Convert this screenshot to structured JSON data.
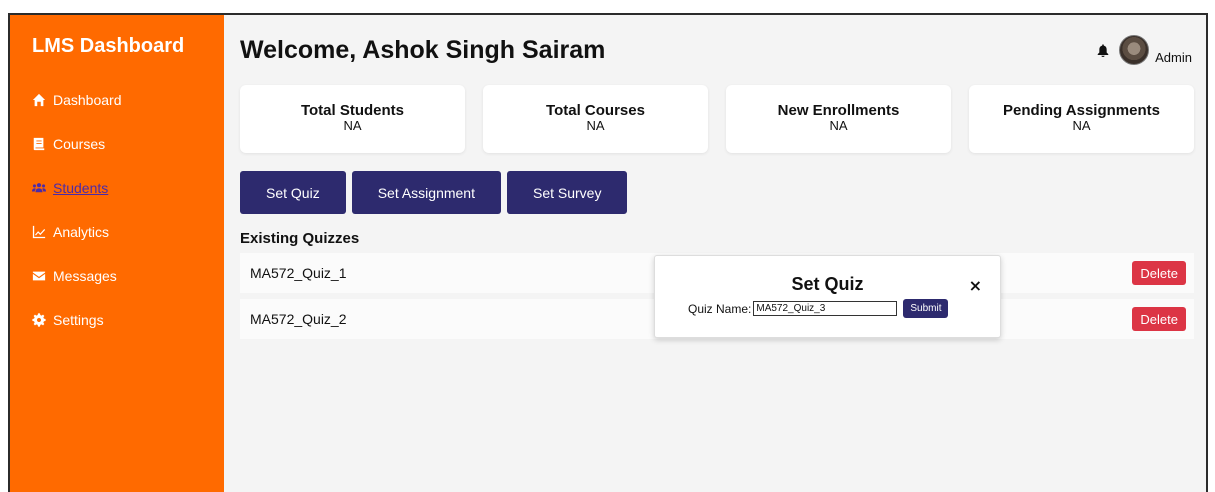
{
  "sidebar": {
    "brand": "LMS Dashboard",
    "items": [
      {
        "label": "Dashboard",
        "icon": "home-icon"
      },
      {
        "label": "Courses",
        "icon": "book-icon"
      },
      {
        "label": "Students",
        "icon": "users-icon",
        "active": true
      },
      {
        "label": "Analytics",
        "icon": "chart-line-icon"
      },
      {
        "label": "Messages",
        "icon": "envelope-icon"
      },
      {
        "label": "Settings",
        "icon": "gear-icon"
      }
    ],
    "color": "#ff6a00",
    "active_color": "#4b2ba8"
  },
  "header": {
    "welcome": "Welcome, Ashok Singh Sairam",
    "user_label": "Admin"
  },
  "stats": [
    {
      "title": "Total Students",
      "value": "NA"
    },
    {
      "title": "Total Courses",
      "value": "NA"
    },
    {
      "title": "New Enrollments",
      "value": "NA"
    },
    {
      "title": "Pending Assignments",
      "value": "NA"
    }
  ],
  "actions": {
    "set_quiz": "Set Quiz",
    "set_assignment": "Set Assignment",
    "set_survey": "Set Survey",
    "color": "#2d2a6e"
  },
  "quizzes": {
    "title": "Existing Quizzes",
    "items": [
      {
        "name": "MA572_Quiz_1",
        "delete_label": "Delete"
      },
      {
        "name": "MA572_Quiz_2",
        "delete_label": "Delete"
      }
    ],
    "delete_color": "#dc3545"
  },
  "modal": {
    "title": "Set Quiz",
    "close": "×",
    "label": "Quiz Name:",
    "input_value": "MA572_Quiz_3",
    "submit": "Submit"
  }
}
